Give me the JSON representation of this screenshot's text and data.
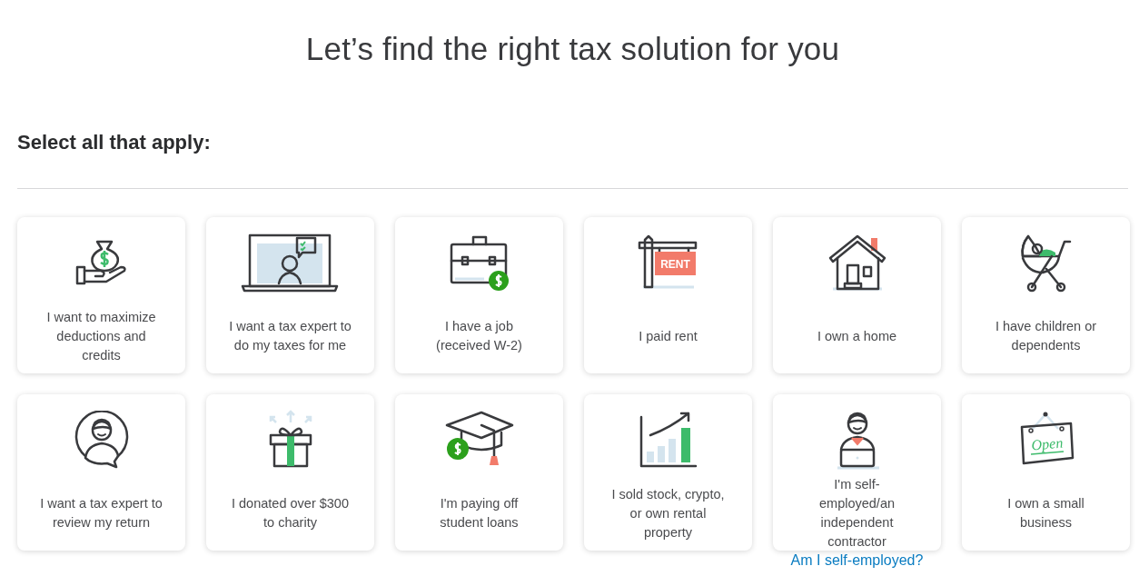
{
  "title": "Let’s find the right tax solution for you",
  "prompt": "Select all that apply:",
  "cards": [
    {
      "kind": "money-bag",
      "label": "I want to maximize\ndeductions and\ncredits"
    },
    {
      "kind": "laptop-expert",
      "label": "I want a tax expert to\ndo my taxes for me"
    },
    {
      "kind": "briefcase",
      "label": "I have a job\n(received W-2)"
    },
    {
      "kind": "rent-sign",
      "label": "I paid rent",
      "sign_text": "RENT"
    },
    {
      "kind": "house",
      "label": "I own a home"
    },
    {
      "kind": "stroller",
      "label": "I have children or\ndependents"
    },
    {
      "kind": "expert-avatar",
      "label": "I want a tax expert to\nreview my return"
    },
    {
      "kind": "gift",
      "label": "I donated over $300\nto charity"
    },
    {
      "kind": "grad-cap",
      "label": "I'm paying off\nstudent loans"
    },
    {
      "kind": "chart",
      "label": "I sold stock, crypto,\nor own rental\nproperty"
    },
    {
      "kind": "freelancer",
      "label": "I'm self-\nemployed/an\nindependent\ncontractor",
      "link": "Am I self-employed?"
    },
    {
      "kind": "open-sign",
      "label": "I own a small\nbusiness",
      "sign_text": "Open"
    }
  ]
}
